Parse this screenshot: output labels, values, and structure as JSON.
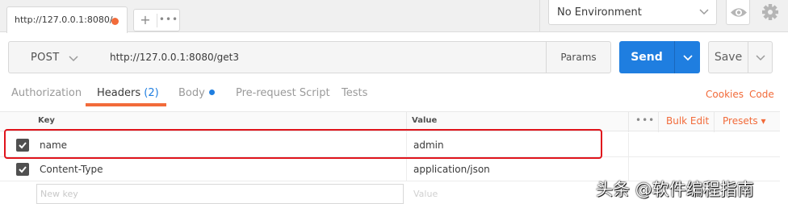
{
  "tab": {
    "title": "http://127.0.0.1:8080/",
    "add_label": "+",
    "more_label": "•••"
  },
  "environment": {
    "selected": "No Environment"
  },
  "icons": {
    "eye": "eye-icon",
    "gear": "gear-icon",
    "chevron": "chevron-down-icon",
    "checkbox": "check-icon"
  },
  "request": {
    "method": "POST",
    "url": "http://127.0.0.1:8080/get3",
    "params_label": "Params",
    "send_label": "Send",
    "save_label": "Save"
  },
  "subtabs": {
    "authorization": "Authorization",
    "headers": "Headers",
    "headers_count": "(2)",
    "body": "Body",
    "prerequest": "Pre-request Script",
    "tests": "Tests",
    "cookies": "Cookies",
    "code": "Code"
  },
  "table": {
    "key_header": "Key",
    "value_header": "Value",
    "more_label": "•••",
    "bulk_edit": "Bulk Edit",
    "presets": "Presets",
    "rows": [
      {
        "key": "name",
        "value": "admin"
      },
      {
        "key": "Content-Type",
        "value": "application/json"
      }
    ],
    "new_key_placeholder": "New key",
    "new_value_placeholder": "Value"
  },
  "colors": {
    "accent": "#f26b3a",
    "primary": "#1f7ee0",
    "highlight_box": "#e0141c"
  },
  "watermark": "头条 @软件编程指南"
}
